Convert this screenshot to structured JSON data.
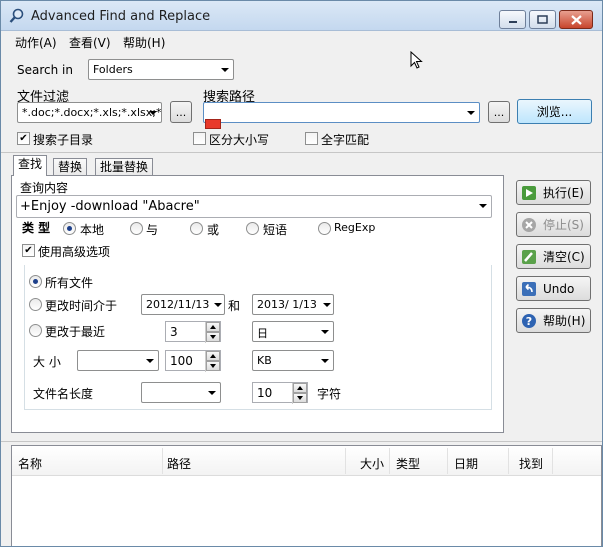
{
  "window": {
    "title": "Advanced Find and Replace",
    "accent": "#c4d8ef"
  },
  "menu": [
    "动作(A)",
    "查看(V)",
    "帮助(H)"
  ],
  "search": {
    "search_in_label": "Search in",
    "search_in_value": "Folders",
    "file_filter_label": "文件过滤",
    "file_filter_value": "*.doc;*.docx;*.xls;*.xlsx;*.h",
    "search_path_label": "搜索路径",
    "search_path_value": "",
    "browse_label": "浏览...",
    "ellipsis": "...",
    "subdirs_label": "搜索子目录",
    "subdirs_checked": true,
    "case_label": "区分大小写",
    "case_checked": false,
    "whole_word_label": "全字匹配",
    "whole_word_checked": false
  },
  "tabs": [
    "查找",
    "替换",
    "批量替换"
  ],
  "find": {
    "query_label": "查询内容",
    "query_value": "+Enjoy -download \"Abacre\"",
    "type_label": "类 型",
    "types": [
      "本地",
      "与",
      "或",
      "短语",
      "RegExp"
    ],
    "type_selected": 0,
    "advanced_label": "使用高级选项",
    "advanced_checked": true,
    "all_files_label": "所有文件",
    "modified_between_label": "更改时间介于",
    "date_from": "2012/11/13",
    "and_label": "和",
    "date_to": "2013/ 1/13",
    "modified_recent_label": "更改于最近",
    "recent_value": "3",
    "recent_unit": "日",
    "size_label": "大 小",
    "size_op": "",
    "size_value": "100",
    "size_unit": "KB",
    "name_length_label": "文件名长度",
    "name_length_op": "",
    "name_length_value": "10",
    "chars_label": "字符"
  },
  "actions": {
    "execute": "执行(E)",
    "stop": "停止(S)",
    "clear": "清空(C)",
    "undo": "Undo",
    "help": "帮助(H)"
  },
  "results": {
    "columns": [
      "名称",
      "路径",
      "大小",
      "类型",
      "日期",
      "找到"
    ]
  }
}
